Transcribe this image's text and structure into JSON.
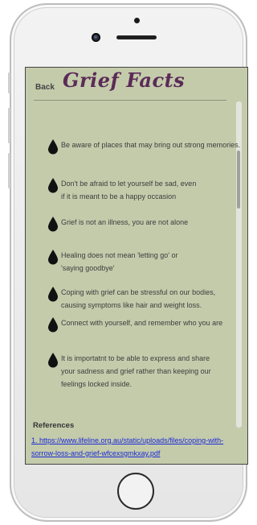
{
  "header": {
    "title": "Grief Facts",
    "back_label": "Back"
  },
  "facts": [
    {
      "text": "Be aware of places that may bring out strong memories."
    },
    {
      "text": "Don't be afraid to let yourself be sad, even\nif it is meant to be a happy occasion"
    },
    {
      "text": "Grief is not an illness, you are not alone"
    },
    {
      "text": "Healing does not mean 'letting go' or\n'saying goodbye'"
    },
    {
      "text": "Coping with grief can be stressful on our bodies,\ncausing symptoms like hair and weight loss."
    },
    {
      "text": "Connect with yourself, and remember who you are"
    },
    {
      "text": "It is importatnt to be able to express and share\nyour sadness and grief rather than keeping our\nfeelings locked inside."
    }
  ],
  "references": {
    "title": "References",
    "link": "1. https://www.lifeline.org.au/static/uploads/files/coping-with-sorrow-loss-and-grief-wfcexsgmkxay.pdf"
  },
  "colors": {
    "screen_bg": "#c4cbab",
    "title": "#5b2b57",
    "link": "#1b2ad6",
    "drop": "#111111"
  },
  "icons": {
    "fact_bullet": "water-drop-icon",
    "home": "home-button"
  }
}
